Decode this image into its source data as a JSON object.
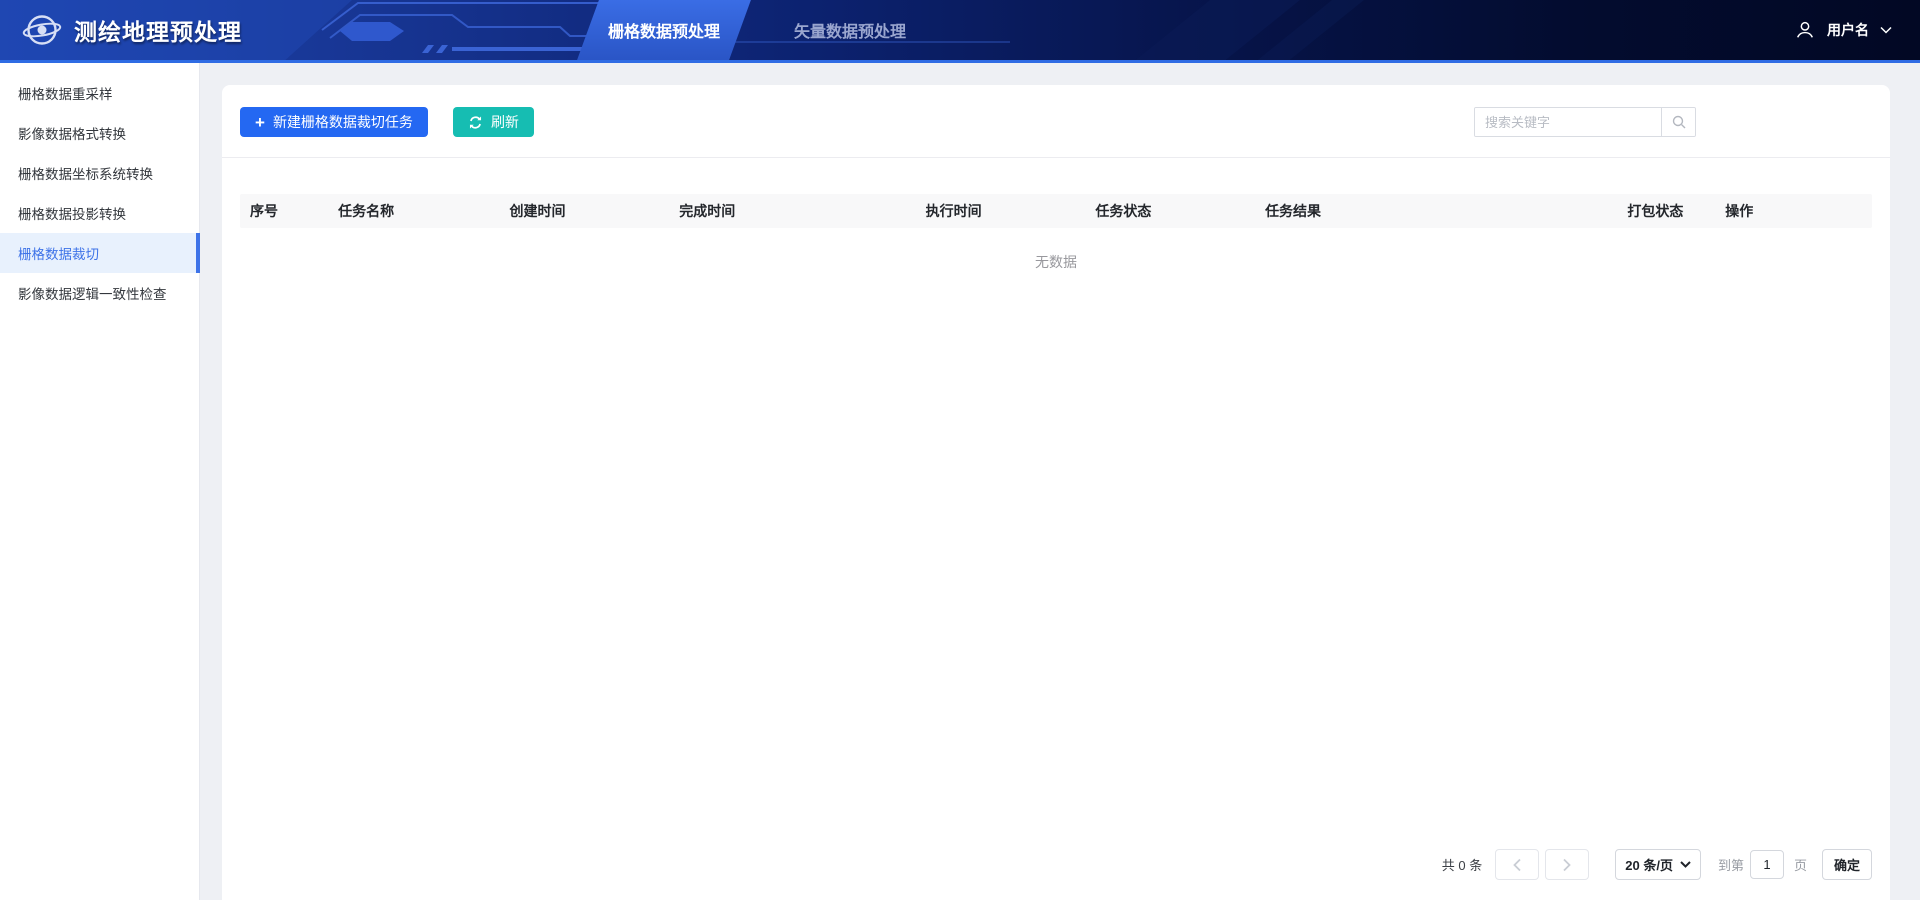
{
  "header": {
    "title": "测绘地理预处理",
    "tabs": [
      {
        "label": "栅格数据预处理",
        "active": true
      },
      {
        "label": "矢量数据预处理",
        "active": false
      }
    ],
    "user_name": "用户名"
  },
  "sidebar": {
    "items": [
      {
        "label": "栅格数据重采样"
      },
      {
        "label": "影像数据格式转换"
      },
      {
        "label": "栅格数据坐标系统转换"
      },
      {
        "label": "栅格数据投影转换"
      },
      {
        "label": "栅格数据裁切"
      },
      {
        "label": "影像数据逻辑一致性检查"
      }
    ],
    "active_index": 4
  },
  "toolbar": {
    "new_task_label": "新建栅格数据裁切任务",
    "refresh_label": "刷新",
    "search_placeholder": "搜索关键字"
  },
  "table": {
    "columns": [
      "序号",
      "任务名称",
      "创建时间",
      "完成时间",
      "执行时间",
      "任务状态",
      "任务结果",
      "打包状态",
      "操作"
    ],
    "rows": [],
    "empty_text": "无数据"
  },
  "pagination": {
    "total_label": "共 0 条",
    "page_size_label": "20 条/页",
    "goto_prefix": "到第",
    "page_value": "1",
    "goto_suffix": "页",
    "confirm_label": "确定"
  },
  "icons": {
    "logo": "globe-orbit-icon",
    "user": "user-icon",
    "user_dropdown": "chevron-down-icon",
    "new_task": "plus-icon",
    "refresh": "refresh-icon",
    "search": "search-icon",
    "prev": "chevron-left-icon",
    "next": "chevron-right-icon",
    "page_size": "chevron-down-icon"
  },
  "colors": {
    "primary_blue": "#2468f2",
    "teal_green": "#16bdb2",
    "header_accent_line": "#2f6ce4",
    "active_tab_blue": "#3a6de5",
    "sidebar_active_blue": "#3e73e8",
    "sidebar_active_bg": "#e8f1fd",
    "table_header_bg": "#f8f8f9",
    "page_bg": "#eef0f4"
  }
}
